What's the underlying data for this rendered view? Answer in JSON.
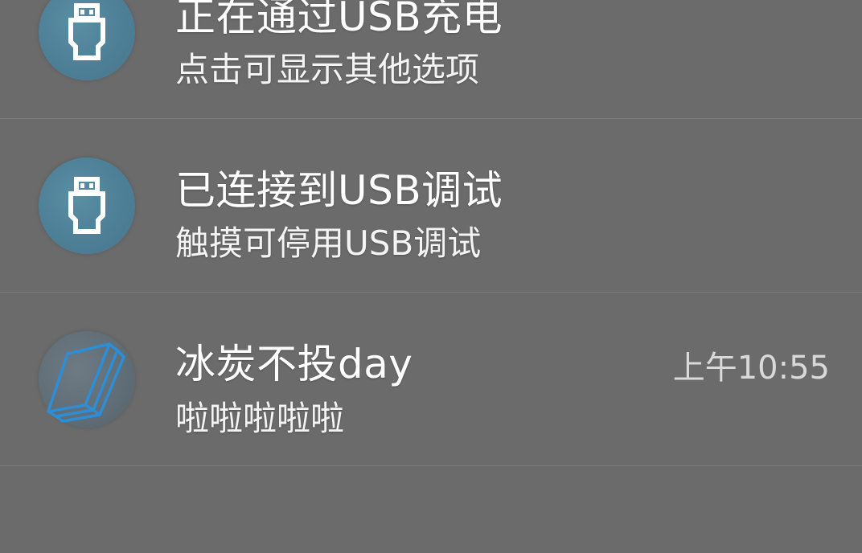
{
  "notifications": [
    {
      "icon": "usb-icon",
      "title": "正在通过USB充电",
      "subtitle": "点击可显示其他选项"
    },
    {
      "icon": "usb-icon",
      "title": "已连接到USB调试",
      "subtitle": "触摸可停用USB调试"
    },
    {
      "icon": "book-icon",
      "title": "冰炭不投day",
      "subtitle": "啦啦啦啦啦",
      "time": "上午10:55"
    }
  ],
  "colors": {
    "background": "#6b6b6b",
    "usb_icon_circle": "#4d7f97",
    "book_icon_stroke": "#2d8ed8"
  }
}
